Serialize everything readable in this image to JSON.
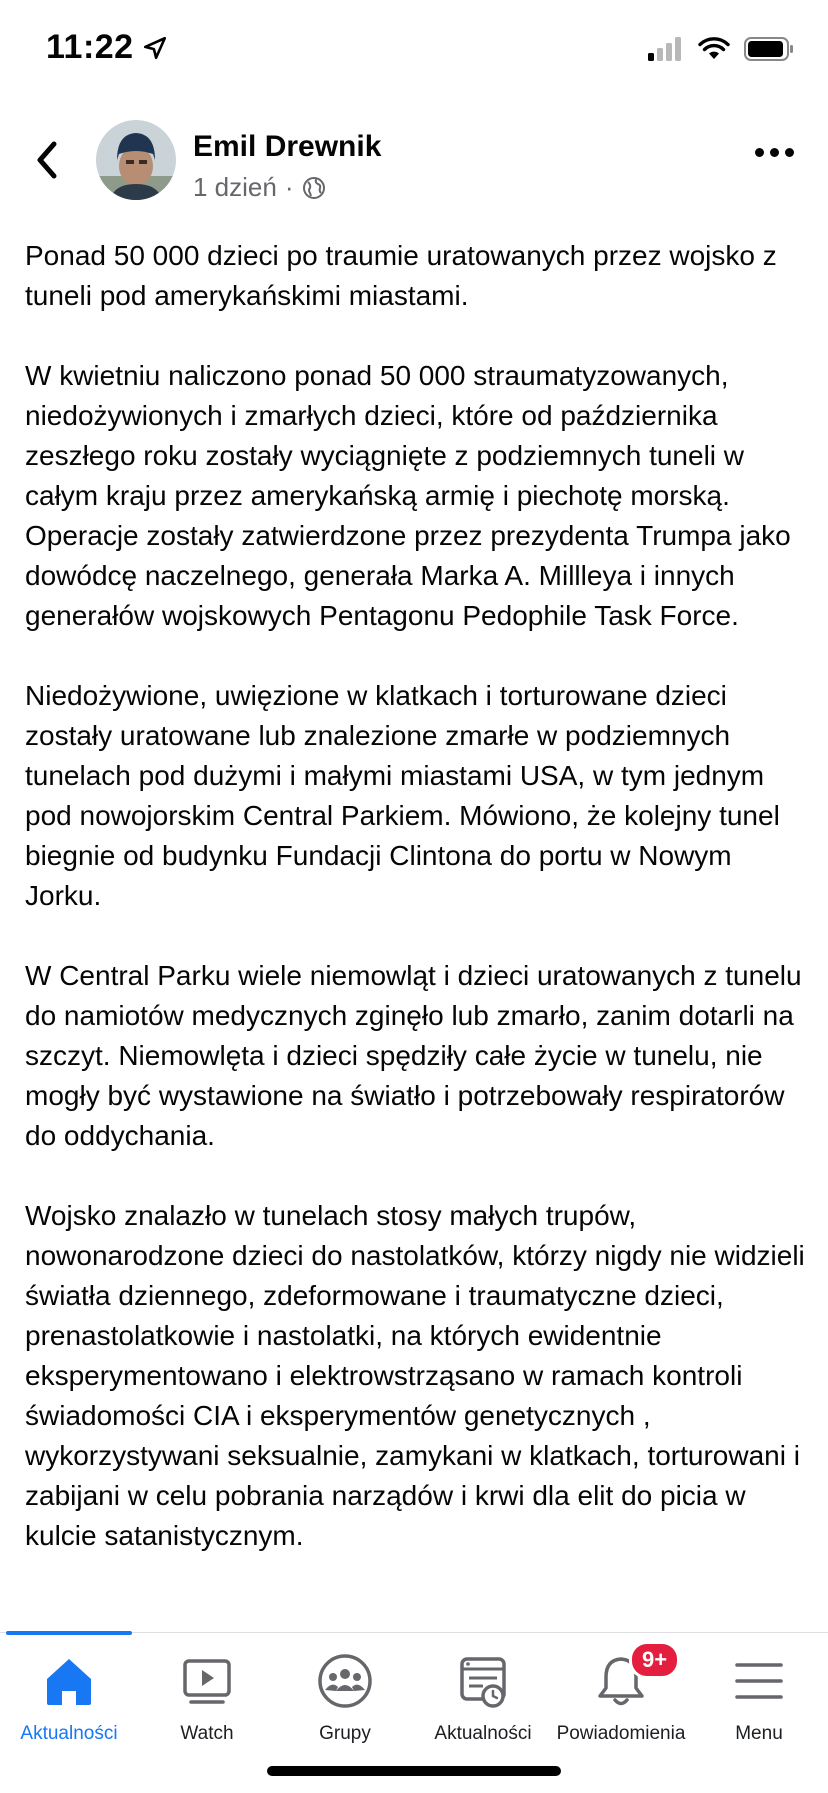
{
  "status_bar": {
    "time": "11:22"
  },
  "post": {
    "author": "Emil Drewnik",
    "time": "1 dzień",
    "separator": "·",
    "paragraphs": [
      "Ponad 50 000 dzieci po traumie uratowanych przez wojsko z tuneli pod amerykańskimi miastami.",
      "W kwietniu naliczono ponad 50 000 straumatyzowanych, niedożywionych i zmarłych dzieci, które od października zeszłego roku zostały wyciągnięte z podziemnych tuneli w całym kraju przez amerykańską armię i piechotę morską. Operacje zostały zatwierdzone przez prezydenta Trumpa jako dowódcę naczelnego, generała Marka A. Millleya i innych generałów wojskowych Pentagonu Pedophile Task Force.",
      "Niedożywione, uwięzione w klatkach i torturowane dzieci zostały uratowane lub znalezione zmarłe w podziemnych tunelach pod dużymi i małymi miastami USA, w tym jednym pod nowojorskim Central Parkiem. Mówiono, że kolejny tunel biegnie od budynku Fundacji Clintona do portu w Nowym Jorku.",
      "W Central Parku wiele niemowląt i dzieci uratowanych z tunelu do namiotów medycznych zginęło lub zmarło, zanim dotarli na szczyt. Niemowlęta i dzieci spędziły całe życie w tunelu, nie mogły być wystawione na światło i potrzebowały respiratorów do oddychania.",
      "Wojsko znalazło w tunelach stosy małych trupów, nowonarodzone dzieci do nastolatków, którzy nigdy nie widzieli światła dziennego, zdeformowane i traumatyczne dzieci, prenastolatkowie i nastolatki, na których ewidentnie eksperymentowano i elektrowstrząsano w ramach kontroli świadomości CIA i eksperymentów genetycznych , wykorzystywani seksualnie, zamykani w klatkach, torturowani i zabijani w celu pobrania narządów i krwi dla elit do picia w kulcie satanistycznym."
    ]
  },
  "tab_bar": {
    "tabs": [
      {
        "label": "Aktualności",
        "icon": "home-icon",
        "active": true
      },
      {
        "label": "Watch",
        "icon": "video-icon"
      },
      {
        "label": "Grupy",
        "icon": "groups-icon"
      },
      {
        "label": "Aktualności",
        "icon": "news-feed-icon"
      },
      {
        "label": "Powiadomienia",
        "icon": "bell-icon",
        "badge": "9+"
      },
      {
        "label": "Menu",
        "icon": "menu-icon"
      }
    ]
  },
  "colors": {
    "accent": "#1877f2",
    "badge": "#e41e3f",
    "meta_text": "#65676b"
  }
}
